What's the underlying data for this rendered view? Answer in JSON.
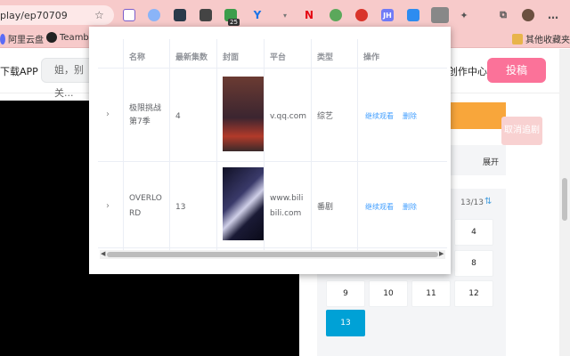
{
  "browser": {
    "url": "play/ep70709",
    "ext_badge": "25",
    "bookmarks": [
      {
        "label": "阿里云盘"
      },
      {
        "label": "Teambition"
      },
      {
        "label": "其他收藏夹"
      }
    ]
  },
  "header": {
    "download_app": "下载APP",
    "search_placeholder": "姐，别关...",
    "creator_center": "创作中心",
    "upload_label": "投稿"
  },
  "side": {
    "cancel_chase": "取消追剧",
    "expand_label": "展开",
    "episode_count": "13/13",
    "episodes": [
      {
        "label": "4",
        "active": false
      },
      {
        "label": "8",
        "active": false
      },
      {
        "label": "9",
        "active": false
      },
      {
        "label": "10",
        "active": false
      },
      {
        "label": "11",
        "active": false
      },
      {
        "label": "12",
        "active": false
      },
      {
        "label": "13",
        "active": true
      }
    ]
  },
  "popup": {
    "columns": [
      "名称",
      "最新集数",
      "封面",
      "平台",
      "类型",
      "操作"
    ],
    "rows": [
      {
        "name_line1": "极限挑战",
        "name_line2": "第7季",
        "latest": "4",
        "platform": "v.qq.com",
        "type": "综艺",
        "action_continue": "继续观看",
        "action_delete": "删除",
        "cover_color": "#5a3a3a"
      },
      {
        "name_line1": "OVERLO",
        "name_line2": "RD",
        "latest": "13",
        "platform_line1": "www.bili",
        "platform_line2": "bili.com",
        "type": "番剧",
        "action_continue": "继续观看",
        "action_delete": "删除",
        "cover_color": "#1c1a3a"
      }
    ]
  },
  "colors": {
    "chrome": "#f7caca",
    "upload_pink": "#fb7299",
    "link_blue": "#409eff",
    "active_episode": "#00a1d6",
    "orange_bar": "#f8a63b"
  }
}
